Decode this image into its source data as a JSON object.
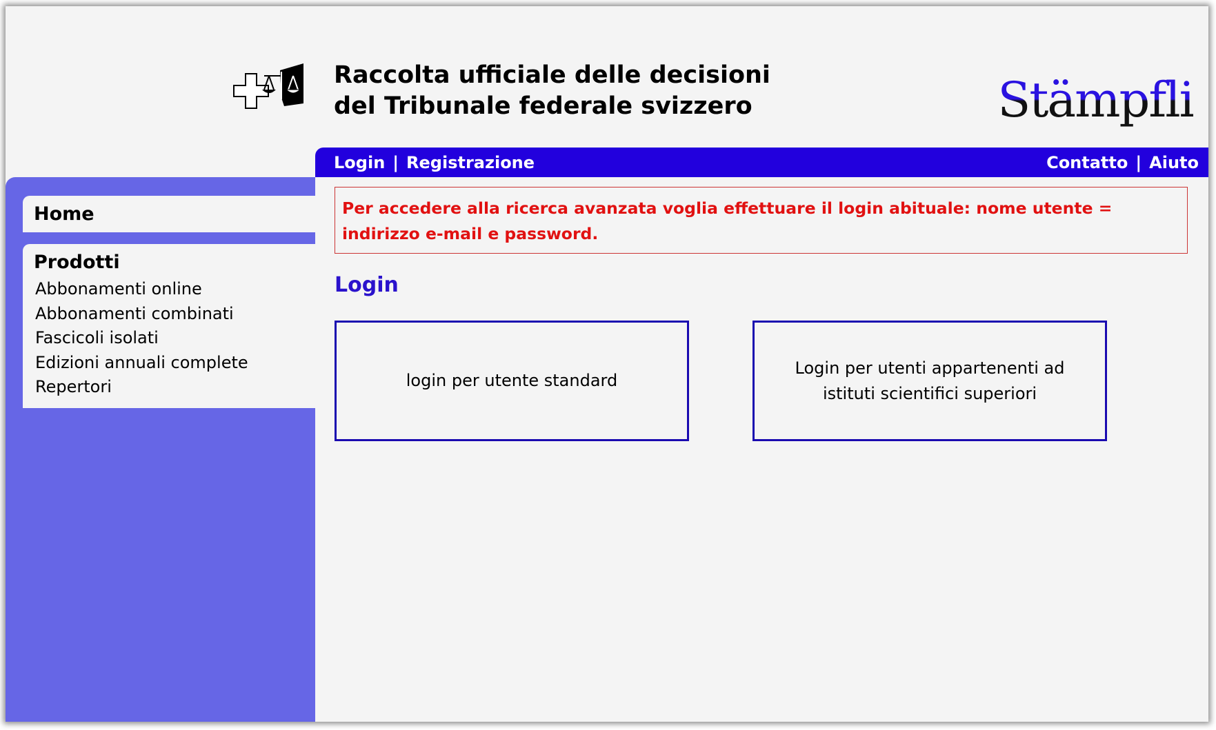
{
  "header": {
    "title_line1": "Raccolta ufficiale delle decisioni",
    "title_line2": "del Tribunale federale svizzero",
    "brand": "Stämpfli",
    "emblem_icon": "swiss-cross-scales-emblem"
  },
  "topbar": {
    "login": "Login",
    "separator": "|",
    "registration": "Registrazione",
    "contact": "Contatto",
    "help": "Aiuto",
    "color": "#2200dd"
  },
  "sidebar": {
    "home": "Home",
    "products_title": "Prodotti",
    "products": [
      "Abbonamenti online",
      "Abbonamenti combinati",
      "Fascicoli isolati",
      "Edizioni annuali complete",
      "Repertori"
    ],
    "color": "#6666e6"
  },
  "main": {
    "alert": "Per accedere alla ricerca avanzata voglia effettuare il login abituale: nome utente = indirizzo e-mail e password.",
    "login_heading": "Login",
    "login_standard": "login per utente standard",
    "login_scientific": "Login per utenti appartenenti ad istituti scientifici superiori"
  }
}
